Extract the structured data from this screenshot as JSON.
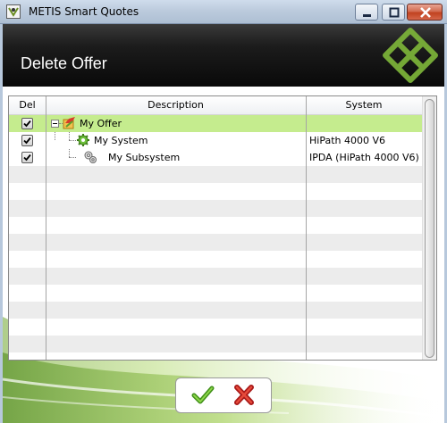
{
  "window": {
    "title": "METIS Smart Quotes"
  },
  "header": {
    "title": "Delete Offer"
  },
  "grid": {
    "columns": {
      "del": "Del",
      "description": "Description",
      "system": "System"
    },
    "rows": [
      {
        "checked": true,
        "description": "My Offer",
        "system": ""
      },
      {
        "checked": true,
        "description": "My System",
        "system": "HiPath 4000 V6"
      },
      {
        "checked": true,
        "description": "My Subsystem",
        "system": "IPDA (HiPath 4000 V6)"
      }
    ],
    "empty_row_count": 11
  },
  "colors": {
    "selected_row": "#c5ec8e",
    "accent_green": "#8cc63f",
    "header_bg": "#111111"
  },
  "buttons": {
    "ok_icon": "check-icon",
    "cancel_icon": "cross-icon"
  }
}
